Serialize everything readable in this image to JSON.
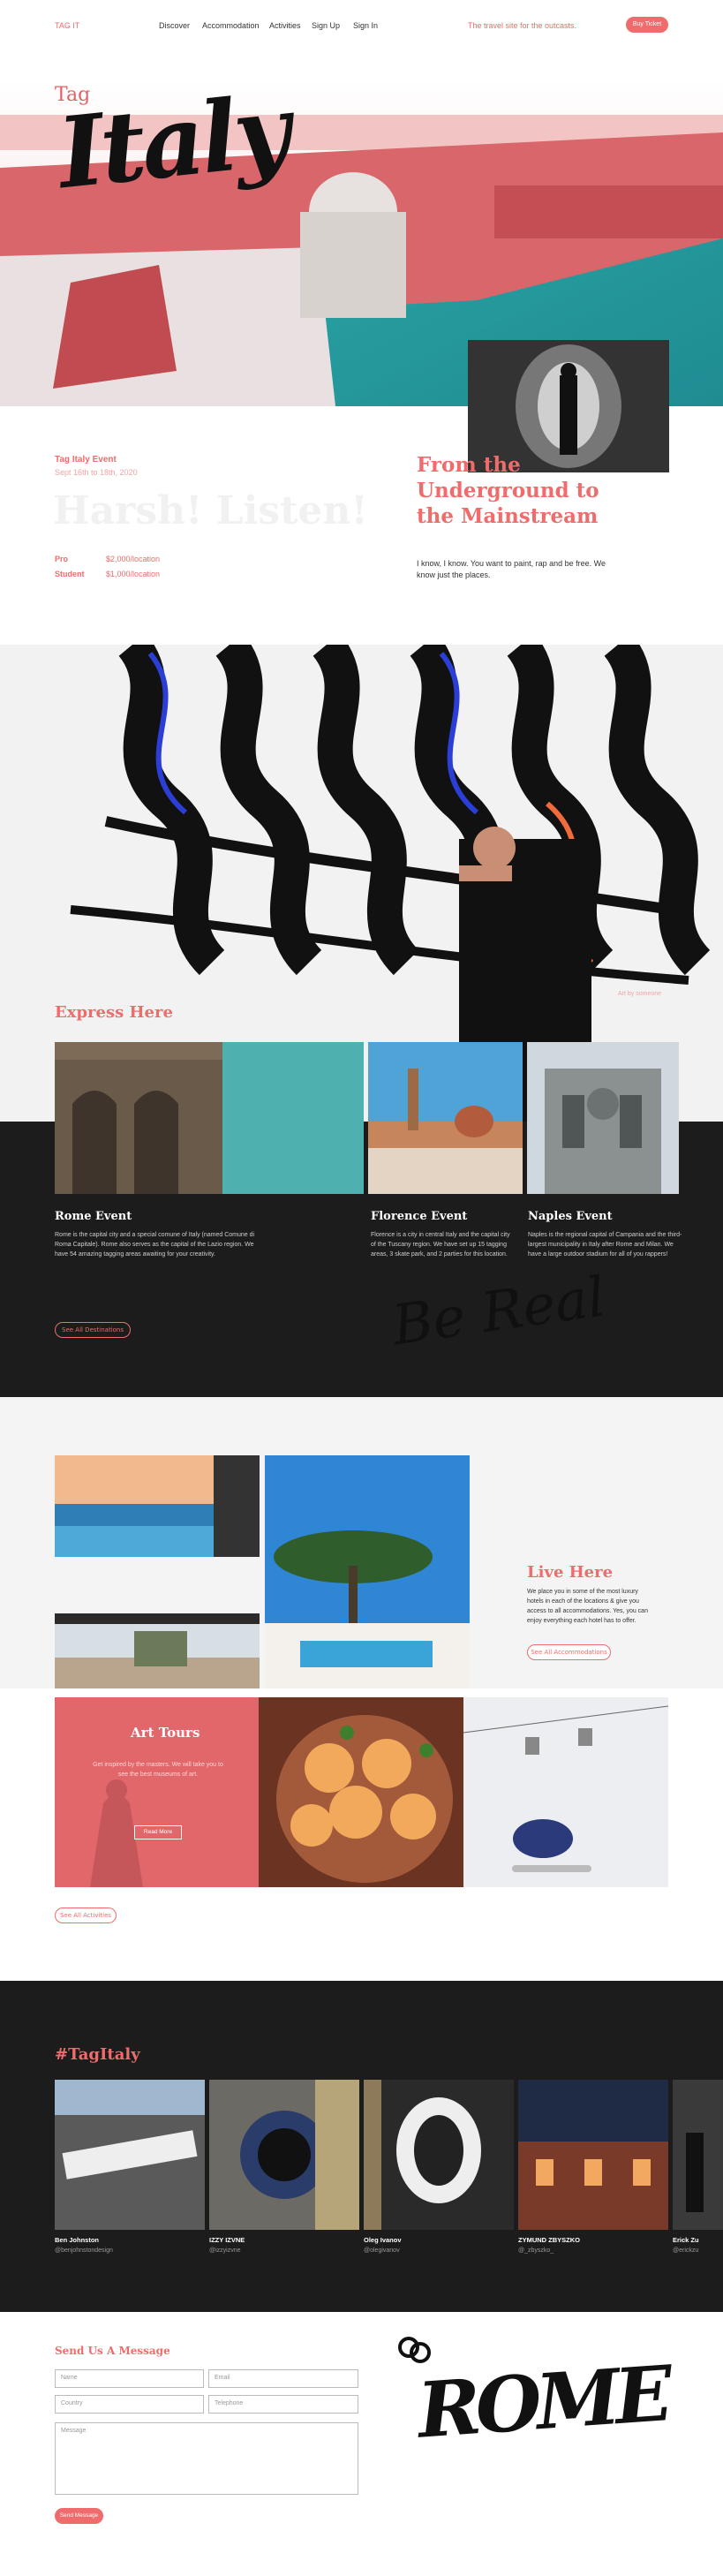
{
  "nav": {
    "logo": "TAG IT",
    "links": [
      "Discover",
      "Accommodation",
      "Activities",
      "Sign Up",
      "Sign In"
    ],
    "tagline": "The travel site for the outcasts.",
    "cta": "Buy Ticket"
  },
  "hero": {
    "tag": "Tag",
    "title": "Italy"
  },
  "event": {
    "label": "Tag Italy Event",
    "dates": "Sept 16th to 18th, 2020",
    "watermark": "Harsh! Listen!",
    "pricing": [
      {
        "tier": "Pro",
        "price": "$2,000/location"
      },
      {
        "tier": "Student",
        "price": "$1,000/location"
      }
    ],
    "headline": "From the Underground to the Mainstream",
    "body": "I know, I know. You want to paint, rap and be free. We know just the places."
  },
  "mural": {
    "heading": "Express Here",
    "credit": "Art by someone"
  },
  "destinations": {
    "cards": [
      {
        "title": "Rome Event",
        "text": "Rome is the capital city and a special comune of Italy (named Comune di Roma Capitale). Rome also serves as the capital of the Lazio region. We have 54 amazing tagging areas awaiting for your creativity."
      },
      {
        "title": "Florence Event",
        "text": "Florence is a city in central Italy and the capital city of the Tuscany region. We have set up 15 tagging areas, 3 skate park, and 2 parties for this location."
      },
      {
        "title": "Naples Event",
        "text": "Naples is the regional capital of Campania and the third-largest municipality in Italy after Rome and Milan. We have a large outdoor stadium for all of you rappers!"
      }
    ],
    "cta": "See All Destinations",
    "script": "Be Real"
  },
  "stay": {
    "heading": "Live Here",
    "text": "We place you in some of the most luxury hotels in each of the locations & give you access to all accommodations. Yes, you can enjoy everything each hotel has to offer.",
    "cta": "See All Accommodations"
  },
  "activities": {
    "heading": "Art Tours",
    "text": "Get inspired by the masters. We will take you to see the best museums of art.",
    "button": "Read More",
    "cta": "See All Activities"
  },
  "social": {
    "hashtag": "#TagItaly",
    "posts": [
      {
        "name": "Ben Johnston",
        "handle": "@benjohnstondesign"
      },
      {
        "name": "IZZY IZVNE",
        "handle": "@izzyizvne"
      },
      {
        "name": "Oleg Ivanov",
        "handle": "@olegivanov"
      },
      {
        "name": "ZYMUND ZBYSZKO",
        "handle": "@_zbyszko_"
      },
      {
        "name": "Erick Zu",
        "handle": "@erickzu"
      }
    ]
  },
  "contact": {
    "heading": "Send Us A Message",
    "fields": {
      "name": "Name",
      "email": "Email",
      "country": "Country",
      "telephone": "Telephone",
      "message": "Message"
    },
    "submit": "Send Message",
    "art": "ROME"
  },
  "colors": {
    "accent": "#f06b6b",
    "dark": "#1c1c1c",
    "light": "#f4f4f4"
  }
}
